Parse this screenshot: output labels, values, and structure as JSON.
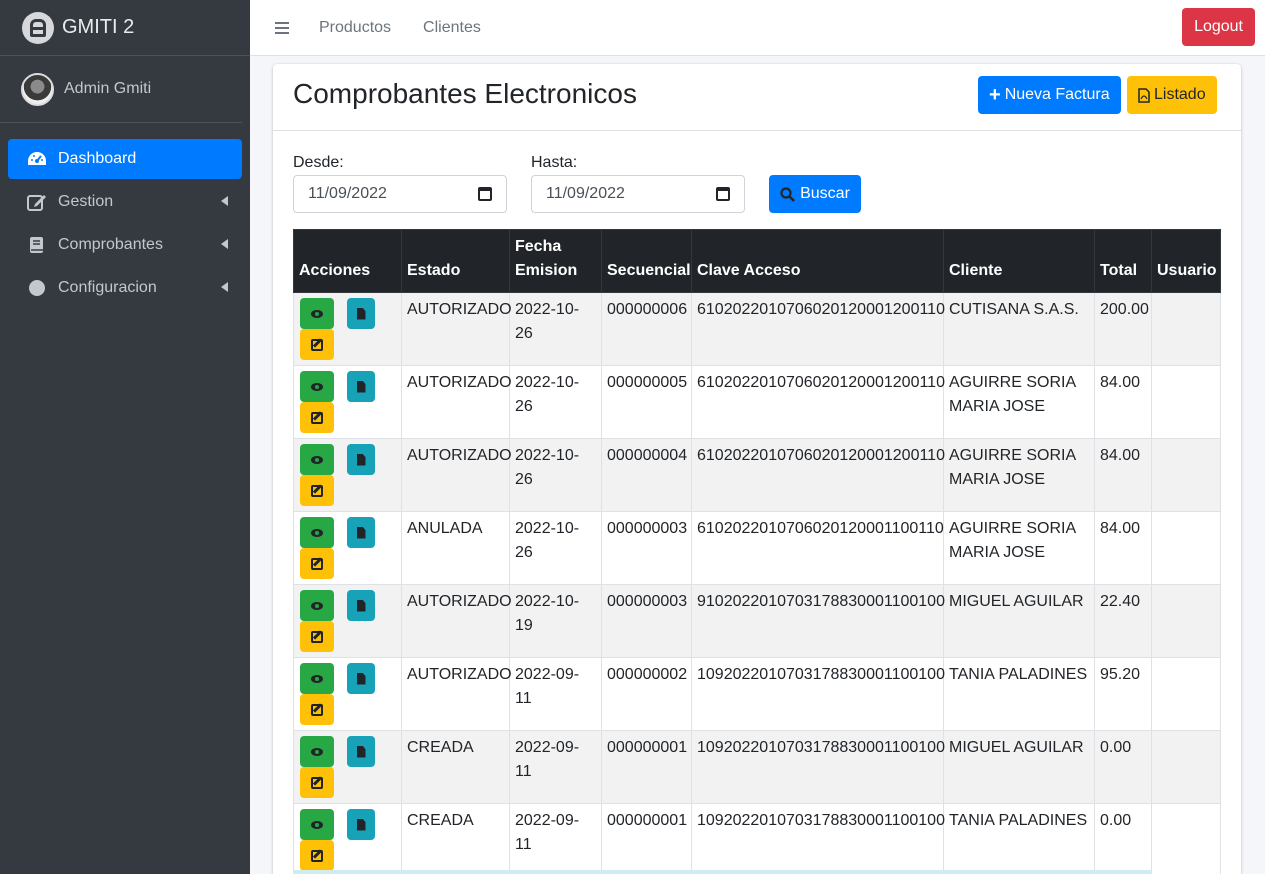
{
  "brand": {
    "name": "GMITI 2"
  },
  "user": {
    "name": "Admin Gmiti"
  },
  "sidebar": {
    "items": [
      {
        "label": "Dashboard",
        "icon": "tachometer-icon",
        "active": true
      },
      {
        "label": "Gestion",
        "icon": "edit-icon"
      },
      {
        "label": "Comprobantes",
        "icon": "book-icon"
      },
      {
        "label": "Configuracion",
        "icon": "circle-icon"
      }
    ]
  },
  "topbar": {
    "links": [
      "Productos",
      "Clientes"
    ],
    "logout": "Logout"
  },
  "page": {
    "title": "Comprobantes Electronicos",
    "new_invoice": "Nueva Factura",
    "listing": "Listado"
  },
  "filter": {
    "from_label": "Desde:",
    "from_value": "11/09/2022",
    "to_label": "Hasta:",
    "to_value": "11/09/2022",
    "search": "Buscar"
  },
  "table": {
    "headers": {
      "actions": "Acciones",
      "status": "Estado",
      "date_line1": "Fecha",
      "date_line2": "Emision",
      "sequence": "Secuencial",
      "key": "Clave Acceso",
      "client": "Cliente",
      "total": "Total",
      "user": "Usuario"
    },
    "rows": [
      {
        "status": "AUTORIZADO",
        "date1": "2022-10-",
        "date2": "26",
        "sequence": "000000006",
        "key": "6102022010706020120001200110",
        "client1": "CUTISANA S.A.S.",
        "client2": "",
        "total": "200.00",
        "user": ""
      },
      {
        "status": "AUTORIZADO",
        "date1": "2022-10-",
        "date2": "26",
        "sequence": "000000005",
        "key": "6102022010706020120001200110",
        "client1": "AGUIRRE SORIA",
        "client2": "MARIA JOSE",
        "total": "84.00",
        "user": ""
      },
      {
        "status": "AUTORIZADO",
        "date1": "2022-10-",
        "date2": "26",
        "sequence": "000000004",
        "key": "6102022010706020120001200110",
        "client1": "AGUIRRE SORIA",
        "client2": "MARIA JOSE",
        "total": "84.00",
        "user": ""
      },
      {
        "status": "ANULADA",
        "date1": "2022-10-",
        "date2": "26",
        "sequence": "000000003",
        "key": "6102022010706020120001100110",
        "client1": "AGUIRRE SORIA",
        "client2": "MARIA JOSE",
        "total": "84.00",
        "user": ""
      },
      {
        "status": "AUTORIZADO",
        "date1": "2022-10-",
        "date2": "19",
        "sequence": "000000003",
        "key": "9102022010703178830001100100",
        "client1": "MIGUEL AGUILAR",
        "client2": "",
        "total": "22.40",
        "user": ""
      },
      {
        "status": "AUTORIZADO",
        "date1": "2022-09-",
        "date2": "11",
        "sequence": "000000002",
        "key": "1092022010703178830001100100",
        "client1": "TANIA PALADINES",
        "client2": "",
        "total": "95.20",
        "user": ""
      },
      {
        "status": "CREADA",
        "date1": "2022-09-",
        "date2": "11",
        "sequence": "000000001",
        "key": "1092022010703178830001100100",
        "client1": "MIGUEL AGUILAR",
        "client2": "",
        "total": "0.00",
        "user": ""
      },
      {
        "status": "CREADA",
        "date1": "2022-09-",
        "date2": "11",
        "sequence": "000000001",
        "key": "1092022010703178830001100100",
        "client1": "TANIA PALADINES",
        "client2": "",
        "total": "0.00",
        "user": ""
      }
    ]
  },
  "colors": {
    "primary": "#007bff",
    "success": "#28a745",
    "info": "#17a2b8",
    "warning": "#ffc107",
    "danger": "#dc3545",
    "sidebar": "#343a40"
  }
}
